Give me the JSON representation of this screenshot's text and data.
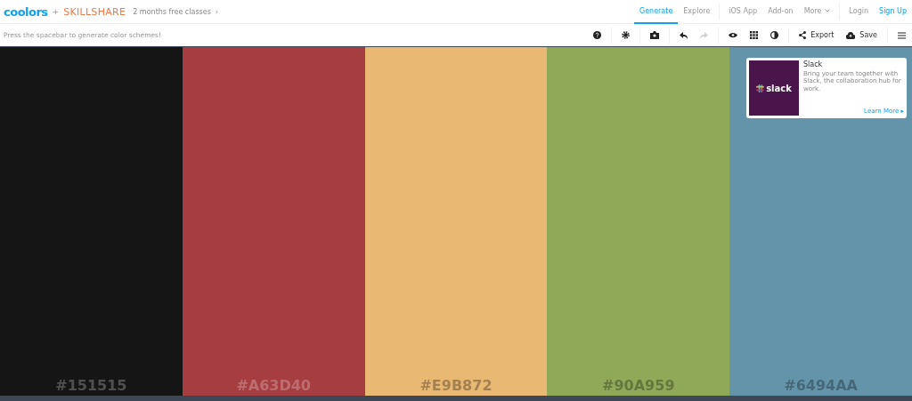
{
  "header": {
    "logo": "coolors",
    "plus": "+",
    "partner": "SKILLSHARE",
    "promo": "2 months free classes",
    "promo_arrow": "›",
    "nav_groups": [
      [
        {
          "label": "Generate",
          "selected": true
        },
        {
          "label": "Explore",
          "selected": false
        }
      ],
      [
        {
          "label": "iOS App",
          "selected": false
        },
        {
          "label": "Add-on",
          "selected": false
        },
        {
          "label": "More",
          "selected": false,
          "dropdown": true
        }
      ],
      [
        {
          "label": "Login",
          "selected": false
        },
        {
          "label": "Sign Up",
          "selected": false,
          "accent": true
        }
      ]
    ]
  },
  "toolbar": {
    "hint": "Press the spacebar to generate color schemes!",
    "tool_groups": [
      [
        {
          "kind": "help"
        }
      ],
      [
        {
          "kind": "settings"
        }
      ],
      [
        {
          "kind": "camera"
        }
      ],
      [
        {
          "kind": "undo",
          "disabled": false
        },
        {
          "kind": "redo",
          "disabled": true
        }
      ],
      [
        {
          "kind": "eye"
        },
        {
          "kind": "grid"
        },
        {
          "kind": "contrast"
        }
      ],
      [
        {
          "kind": "export",
          "label": "Export"
        },
        {
          "kind": "save",
          "label": "Save"
        }
      ],
      [
        {
          "kind": "menu"
        }
      ]
    ]
  },
  "palette": [
    {
      "hex": "#151515",
      "color": "#151515"
    },
    {
      "hex": "#A63D40",
      "color": "#a63d40"
    },
    {
      "hex": "#E9B872",
      "color": "#e9b872"
    },
    {
      "hex": "#90A959",
      "color": "#90a959"
    },
    {
      "hex": "#6494AA",
      "color": "#6494aa"
    }
  ],
  "ad": {
    "logo": "slack",
    "title": "Slack",
    "body": "Bring your team together with Slack, the collaboration hub for work.",
    "link": "Learn More ▸"
  }
}
